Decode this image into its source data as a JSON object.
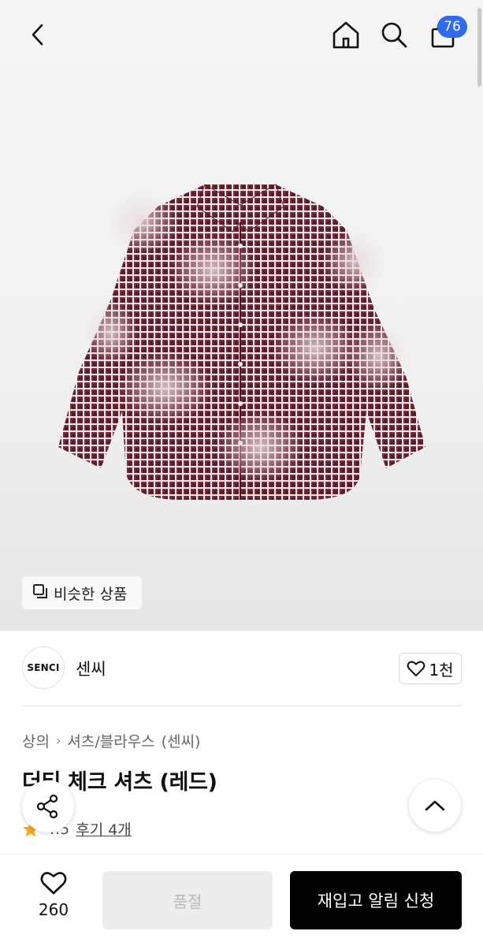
{
  "header": {
    "back_icon": "chevron-left-icon",
    "home_icon": "home-icon",
    "search_icon": "search-icon",
    "cart_icon": "shopping-bag-icon",
    "cart_count": "76",
    "badge_color": "#2f6bf0"
  },
  "hero": {
    "image": "red-check-shirt-photo",
    "similar_label": "비슷한 상품",
    "similar_icon": "similar-items-icon"
  },
  "brand": {
    "logo_text": "SENCI",
    "name": "센씨",
    "like_count": "1천"
  },
  "product": {
    "breadcrumb": [
      "상의",
      "셔츠/블라우스",
      "(센씨)"
    ],
    "title": "더티 체크 셔츠 (레드)",
    "rating": "4.5",
    "review_label": "후기 4개",
    "star_color": "#f5a623"
  },
  "bottom": {
    "like_count": "260",
    "soldout_label": "품절",
    "restock_label": "재입고 알림 신청"
  }
}
